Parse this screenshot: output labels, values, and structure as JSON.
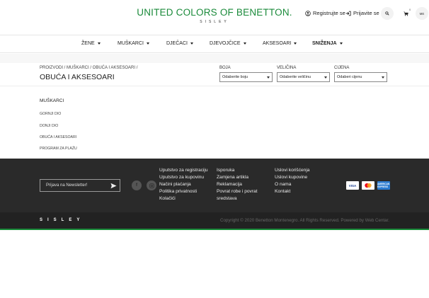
{
  "header": {
    "logo": "UNITED COLORS OF BENETTON.",
    "logo_sub": "SISLEY",
    "register": "Registrujte se",
    "login": "Prijavite se",
    "cart_count": "0",
    "lang": "ME"
  },
  "nav": {
    "items": [
      {
        "label": "ŽENE"
      },
      {
        "label": "MUŠKARCI"
      },
      {
        "label": "DJEČACI"
      },
      {
        "label": "DJEVOJČICE"
      },
      {
        "label": "AKSESOARI"
      },
      {
        "label": "SNIŽENJA"
      }
    ]
  },
  "page": {
    "breadcrumb": "PROIZVODI / MUŠKARCI / OBUĆA I AKSESOARI /",
    "title": "OBUĆA I AKSESOARI"
  },
  "filters": [
    {
      "label": "BOJA",
      "value": "Odaberite boju"
    },
    {
      "label": "VELIČINA",
      "value": "Odaberite veličinu"
    },
    {
      "label": "CIJENA",
      "value": "Odaberi cijenu"
    }
  ],
  "categories": {
    "heading": "MUŠKARCI",
    "items": [
      "GORNJI DIO",
      "DONJI DIO",
      "OBUĆA I AKSESOARI",
      "PROGRAM ZA PLAŽU"
    ]
  },
  "footer": {
    "newsletter_placeholder": "Prijava na Newsletter!",
    "col1": [
      "Uputstvo za registraciju",
      "Uputstvo za kupovinu",
      "Načini plaćanja",
      "Politika privatnosti",
      "Kolačići"
    ],
    "col2": [
      "Isporuka",
      "Zamjena artikla",
      "Reklamacija",
      "Povrat robe i povrat",
      "sredstava"
    ],
    "col3": [
      "Uslovi korišćenja",
      "Uslovi kupovine",
      "O nama",
      "Kontakt"
    ],
    "cards": {
      "visa": "VISA",
      "amex": "AMERICAN EXPRESS"
    },
    "brand": "SISLEY",
    "copyright": "Copyright © 2020 Benetton Montenegro. All Rights Reserved. Powered by Web Centar."
  },
  "colors": {
    "brand_green": "#1a8a3a",
    "footer_bg": "#2a2a2a"
  }
}
